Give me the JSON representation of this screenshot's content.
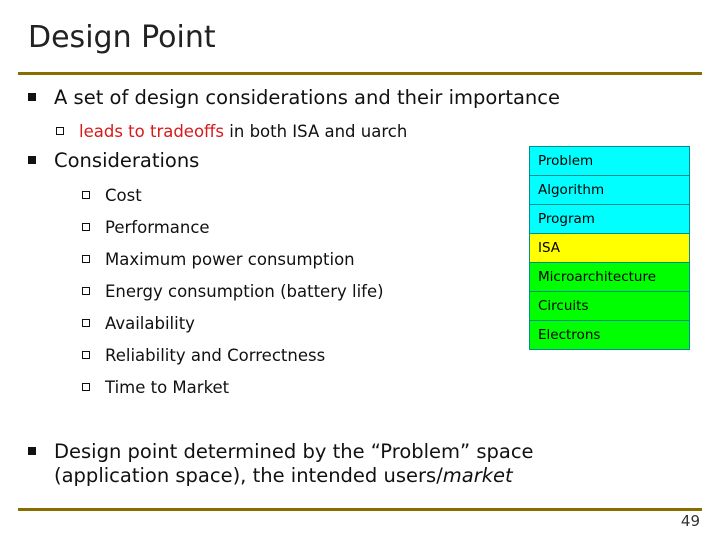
{
  "slide": {
    "title": "Design Point",
    "page_number": "49",
    "rule_color": "#8a6d00",
    "bullets": [
      {
        "level": 1,
        "text": "A set of design considerations and their importance"
      },
      {
        "level": 2,
        "text_highlight": "leads to tradeoffs",
        "text_rest": " in both ISA and uarch",
        "highlight_color": "#d61a1a"
      },
      {
        "level": 1,
        "text": "Considerations"
      },
      {
        "level": 2,
        "text": "Cost"
      },
      {
        "level": 2,
        "text": "Performance"
      },
      {
        "level": 2,
        "text": "Maximum power consumption"
      },
      {
        "level": 2,
        "text": "Energy consumption (battery life)"
      },
      {
        "level": 2,
        "text": "Availability"
      },
      {
        "level": 2,
        "text": "Reliability and Correctness"
      },
      {
        "level": 2,
        "text": "Time to Market"
      },
      {
        "level": 1,
        "line1": "Design point determined by the “Problem” space",
        "line2_plain": "(application space), the intended users/",
        "line2_italic": "market"
      }
    ]
  },
  "stack_diagram": {
    "border_color": "#008f8f",
    "layers": [
      {
        "label": "Problem",
        "color": "#00ffff"
      },
      {
        "label": "Algorithm",
        "color": "#00ffff"
      },
      {
        "label": "Program",
        "color": "#00ffff"
      },
      {
        "label": "ISA",
        "color": "#ffff00"
      },
      {
        "label": "Microarchitecture",
        "color": "#00ff00"
      },
      {
        "label": "Circuits",
        "color": "#00ff00"
      },
      {
        "label": "Electrons",
        "color": "#00ff00"
      }
    ]
  }
}
